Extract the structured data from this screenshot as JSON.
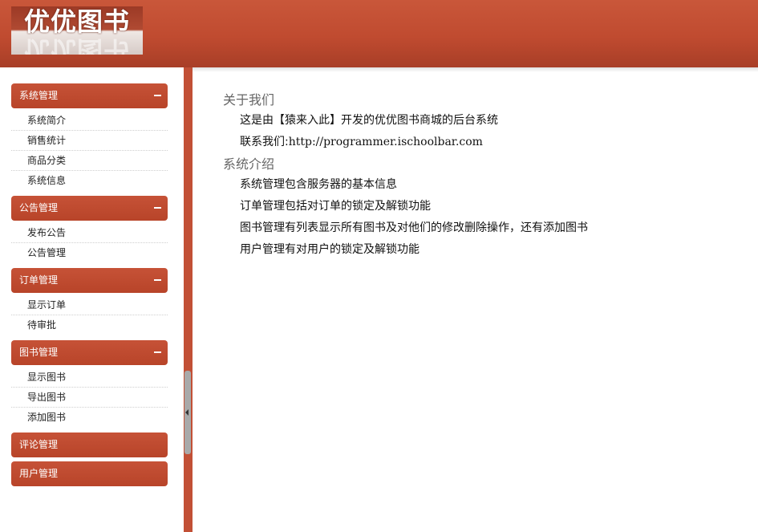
{
  "header": {
    "logo_text": "优优图书"
  },
  "sidebar": {
    "groups": [
      {
        "label": "系统管理",
        "items": [
          "系统简介",
          "销售统计",
          "商品分类",
          "系统信息"
        ]
      },
      {
        "label": "公告管理",
        "items": [
          "发布公告",
          "公告管理"
        ]
      },
      {
        "label": "订单管理",
        "items": [
          "显示订单",
          "待审批"
        ]
      },
      {
        "label": "图书管理",
        "items": [
          "显示图书",
          "导出图书",
          "添加图书"
        ]
      },
      {
        "label": "评论管理",
        "items": []
      },
      {
        "label": "用户管理",
        "items": []
      }
    ]
  },
  "main": {
    "about_title": "关于我们",
    "about_lines": [
      "这是由【猿来入此】开发的优优图书商城的后台系统"
    ],
    "contact_label": "联系我们:",
    "contact_url": "http://programmer.ischoolbar.com",
    "intro_title": "系统介绍",
    "intro_lines": [
      "系统管理包含服务器的基本信息",
      "订单管理包括对订单的锁定及解锁功能",
      "图书管理有列表显示所有图书及对他们的修改删除操作，还有添加图书",
      "用户管理有对用户的锁定及解锁功能"
    ]
  },
  "colors": {
    "brand": "#c04b30",
    "header_dark": "#a83e27",
    "splitter_handle": "#a9a9a9"
  },
  "icons": {
    "collapse": "minus-icon",
    "splitter_toggle": "triangle-left-icon"
  }
}
